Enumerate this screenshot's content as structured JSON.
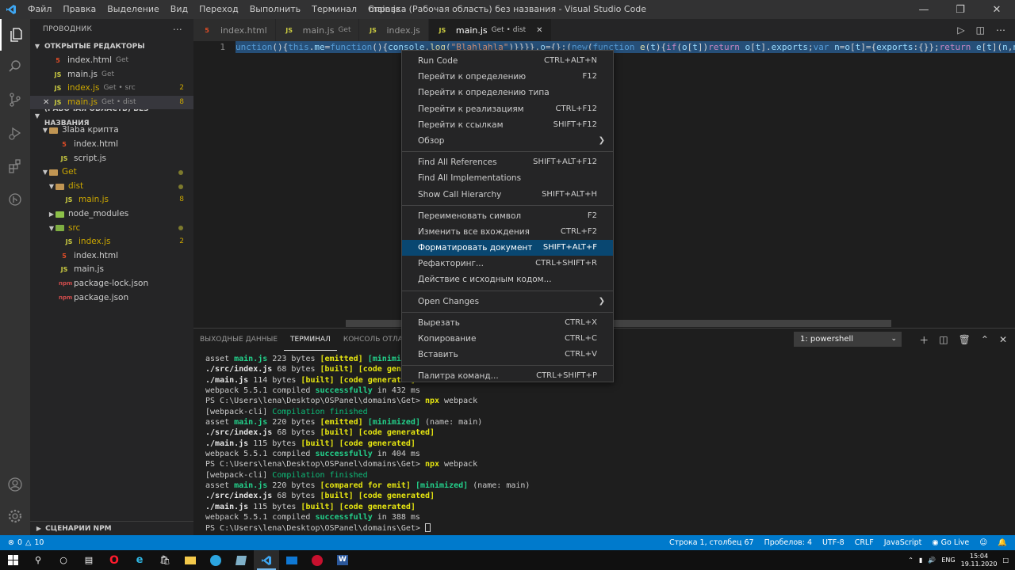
{
  "titlebar": {
    "menu": [
      "Файл",
      "Правка",
      "Выделение",
      "Вид",
      "Переход",
      "Выполнить",
      "Терминал",
      "Справка"
    ],
    "title": "main.js - (Рабочая область) без названия - Visual Studio Code"
  },
  "sidebar": {
    "header": "ПРОВОДНИК",
    "open_editors_title": "ОТКРЫТЫЕ РЕДАКТОРЫ",
    "open_editors": [
      {
        "name": "index.html",
        "desc": "Get",
        "badge": "",
        "type": "html"
      },
      {
        "name": "main.js",
        "desc": "Get",
        "badge": "",
        "type": "js"
      },
      {
        "name": "index.js",
        "desc": "Get • src",
        "badge": "2",
        "type": "js"
      },
      {
        "name": "main.js",
        "desc": "Get • dist",
        "badge": "8",
        "type": "js"
      }
    ],
    "workspace_title": "(РАБОЧАЯ ОБЛАСТЬ) БЕЗ НАЗВАНИЯ",
    "tree": {
      "folder1": "3laba крипта",
      "f1_index": "index.html",
      "f1_script": "script.js",
      "folder2": "Get",
      "dist": "dist",
      "dist_main": "main.js",
      "dist_badge": "8",
      "node_modules": "node_modules",
      "src": "src",
      "src_index": "index.js",
      "src_badge": "2",
      "index_html": "index.html",
      "main_js": "main.js",
      "pkg_lock": "package-lock.json",
      "pkg": "package.json"
    },
    "npm": "СЦЕНАРИИ NPM"
  },
  "tabs": [
    {
      "label": "index.html",
      "desc": "",
      "type": "html"
    },
    {
      "label": "main.js",
      "desc": "Get",
      "type": "js"
    },
    {
      "label": "index.js",
      "desc": "",
      "type": "js"
    },
    {
      "label": "main.js",
      "desc": "Get • dist",
      "type": "js"
    }
  ],
  "editor": {
    "line_number": "1"
  },
  "panel": {
    "tabs": [
      "ВЫХОДНЫЕ ДАННЫЕ",
      "ТЕРМИНАЛ",
      "КОНСОЛЬ ОТЛАДКИ"
    ],
    "terminal_select": "1: powershell"
  },
  "context_menu": [
    {
      "label": "Run Code",
      "shortcut": "CTRL+ALT+N"
    },
    {
      "label": "Перейти к определению",
      "shortcut": "F12"
    },
    {
      "label": "Перейти к определению типа",
      "shortcut": ""
    },
    {
      "label": "Перейти к реализациям",
      "shortcut": "CTRL+F12"
    },
    {
      "label": "Перейти к ссылкам",
      "shortcut": "SHIFT+F12"
    },
    {
      "label": "Обзор",
      "shortcut": ""
    },
    {
      "label": "Find All References",
      "shortcut": "SHIFT+ALT+F12"
    },
    {
      "label": "Find All Implementations",
      "shortcut": ""
    },
    {
      "label": "Show Call Hierarchy",
      "shortcut": "SHIFT+ALT+H"
    },
    {
      "label": "Переименовать символ",
      "shortcut": "F2"
    },
    {
      "label": "Изменить все вхождения",
      "shortcut": "CTRL+F2"
    },
    {
      "label": "Форматировать документ",
      "shortcut": "SHIFT+ALT+F"
    },
    {
      "label": "Рефакторинг...",
      "shortcut": "CTRL+SHIFT+R"
    },
    {
      "label": "Действие с исходным кодом...",
      "shortcut": ""
    },
    {
      "label": "Open Changes",
      "shortcut": ""
    },
    {
      "label": "Вырезать",
      "shortcut": "CTRL+X"
    },
    {
      "label": "Копирование",
      "shortcut": "CTRL+C"
    },
    {
      "label": "Вставить",
      "shortcut": "CTRL+V"
    },
    {
      "label": "Палитра команд...",
      "shortcut": "CTRL+SHIFT+P"
    }
  ],
  "statusbar": {
    "errors": "0",
    "warnings": "10",
    "position": "Строка 1, столбец 67",
    "spaces": "Пробелов: 4",
    "encoding": "UTF-8",
    "eol": "CRLF",
    "language": "JavaScript",
    "golive": "Go Live"
  },
  "taskbar": {
    "lang": "ENG",
    "time": "15:04",
    "date": "19.11.2020"
  },
  "colors": {
    "statusbar": "#007acc",
    "menu_highlight": "#094771",
    "activity": "#333333",
    "sidebar": "#252526",
    "editor": "#1e1e1e"
  }
}
